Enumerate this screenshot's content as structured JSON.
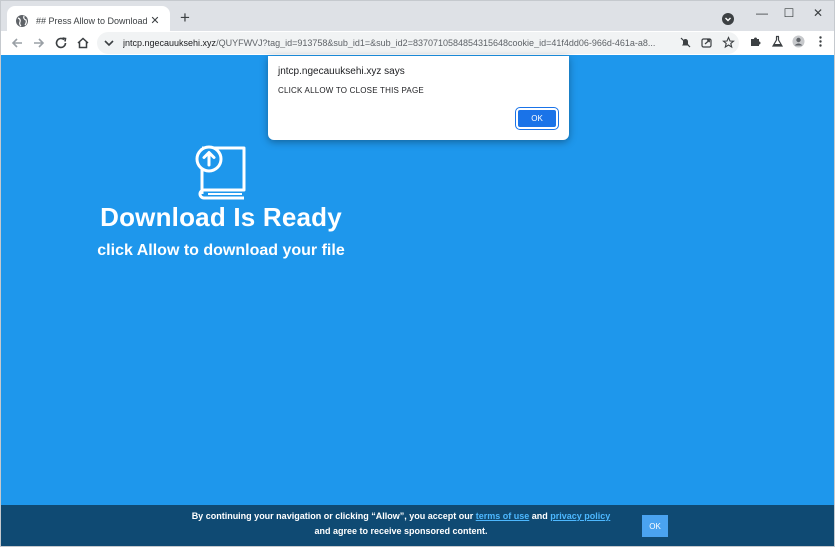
{
  "browser": {
    "tab_title": "## Press Allow to Download ##",
    "tab_close": "✕",
    "new_tab": "+",
    "window_min": "—",
    "window_max": "☐",
    "window_close": "✕",
    "url_host": "jntcp.ngecauuksehi.xyz",
    "url_path": "/QUYFWVJ?tag_id=913758&sub_id1=&sub_id2=8370710584854315648cookie_id=41f4dd06-966d-461a-a8..."
  },
  "dialog": {
    "origin": "jntcp.ngecauuksehi.xyz says",
    "message": "CLICK ALLOW TO CLOSE THIS PAGE",
    "ok_label": "OK"
  },
  "hero": {
    "title": "Download Is Ready",
    "subtitle": "click Allow to download your file"
  },
  "consent": {
    "text_before": "By continuing your navigation or clicking “Allow”, you accept our ",
    "terms_link": "terms of use",
    "text_and": " and ",
    "privacy_link": "privacy policy",
    "text_after": "and agree to receive sponsored content.",
    "ok_label": "OK"
  },
  "colors": {
    "page_bg": "#1e97ec",
    "consent_bg": "#0f4a73",
    "link": "#4db8ff",
    "dialog_button": "#1a73e8"
  }
}
